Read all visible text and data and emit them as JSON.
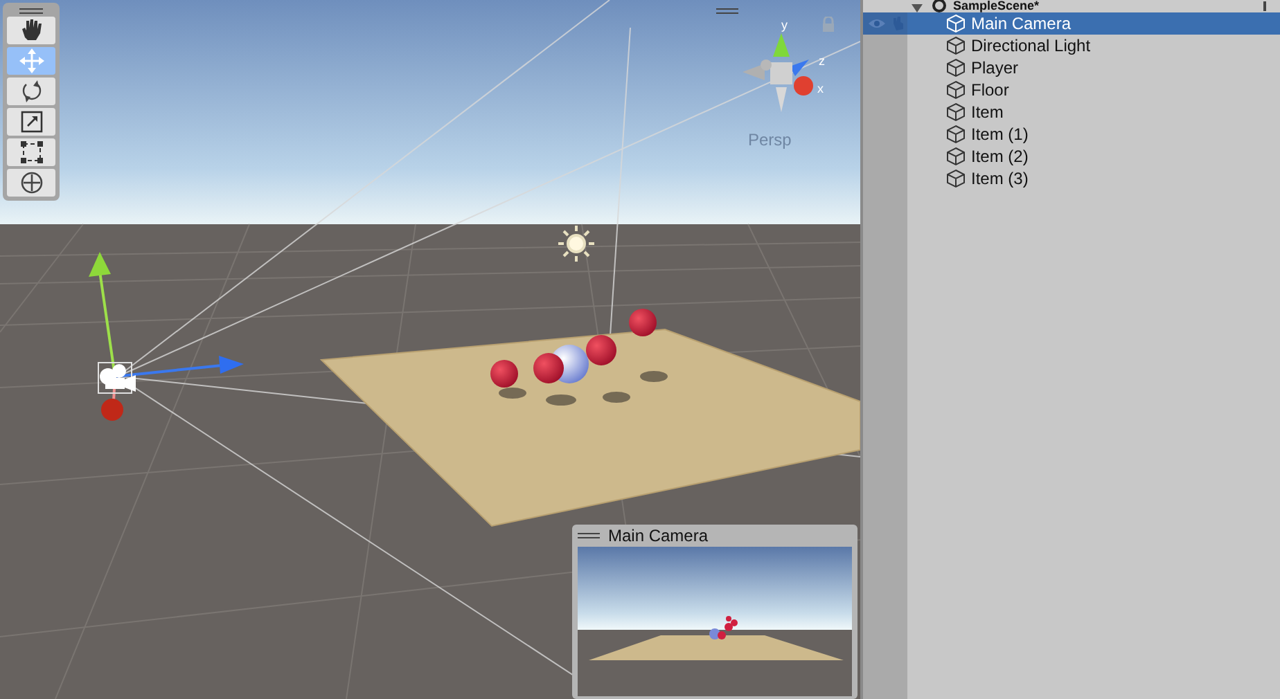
{
  "scene_view": {
    "tools": [
      {
        "kind": "hand",
        "selected": false
      },
      {
        "kind": "move",
        "selected": true
      },
      {
        "kind": "rotate",
        "selected": false
      },
      {
        "kind": "scale",
        "selected": false
      },
      {
        "kind": "rect",
        "selected": false
      },
      {
        "kind": "transform",
        "selected": false
      }
    ],
    "orientation_gizmo": {
      "axis_y": "y",
      "axis_z": "z",
      "axis_x": "x",
      "projection": "Persp"
    },
    "camera_preview": {
      "title": "Main Camera"
    }
  },
  "hierarchy": {
    "scene": {
      "name": "SampleScene*",
      "expanded": true
    },
    "items": [
      {
        "name": "Main Camera",
        "selected": true
      },
      {
        "name": "Directional Light",
        "selected": false
      },
      {
        "name": "Player",
        "selected": false
      },
      {
        "name": "Floor",
        "selected": false
      },
      {
        "name": "Item",
        "selected": false
      },
      {
        "name": "Item (1)",
        "selected": false
      },
      {
        "name": "Item (2)",
        "selected": false
      },
      {
        "name": "Item (3)",
        "selected": false
      }
    ]
  }
}
